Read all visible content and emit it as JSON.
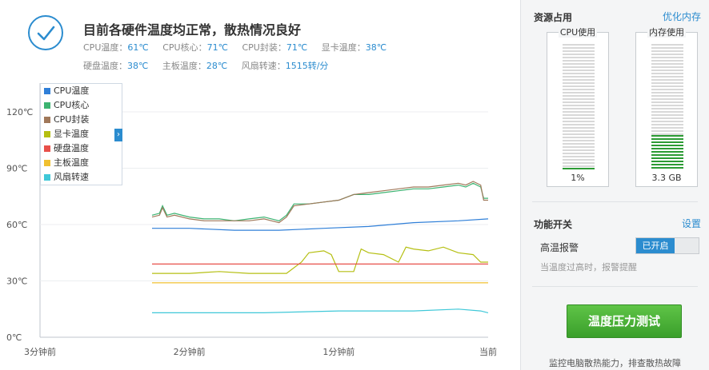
{
  "status": {
    "title": "目前各硬件温度均正常，散热情况良好",
    "temps_row1": [
      {
        "label": "CPU温度：",
        "value": "61℃"
      },
      {
        "label": "CPU核心：",
        "value": "71℃"
      },
      {
        "label": "CPU封装：",
        "value": "71℃"
      },
      {
        "label": "显卡温度：",
        "value": "38℃"
      }
    ],
    "temps_row2": [
      {
        "label": "硬盘温度：",
        "value": "38℃"
      },
      {
        "label": "主板温度：",
        "value": "28℃"
      },
      {
        "label": "风扇转速：",
        "value": "1515转/分"
      }
    ]
  },
  "chart_data": {
    "type": "line",
    "x_categories": [
      "3分钟前",
      "2分钟前",
      "1分钟前",
      "当前"
    ],
    "y_ticks": [
      "0℃",
      "30℃",
      "60℃",
      "90℃",
      "120℃"
    ],
    "ylim": [
      0,
      120
    ],
    "xlim": [
      0,
      3
    ],
    "grid": true,
    "legend_position": "top-left",
    "series": [
      {
        "name": "CPU温度",
        "color": "#2f7fd8",
        "points": [
          [
            0.75,
            58
          ],
          [
            1.0,
            58
          ],
          [
            1.3,
            57
          ],
          [
            1.6,
            57
          ],
          [
            1.9,
            58
          ],
          [
            2.2,
            59
          ],
          [
            2.5,
            61
          ],
          [
            2.8,
            62
          ],
          [
            3.0,
            63
          ]
        ]
      },
      {
        "name": "CPU核心",
        "color": "#3cb371",
        "points": [
          [
            0.75,
            65
          ],
          [
            0.8,
            66
          ],
          [
            0.82,
            70
          ],
          [
            0.85,
            65
          ],
          [
            0.9,
            66
          ],
          [
            1.0,
            64
          ],
          [
            1.1,
            63
          ],
          [
            1.2,
            63
          ],
          [
            1.3,
            62
          ],
          [
            1.4,
            63
          ],
          [
            1.5,
            64
          ],
          [
            1.55,
            63
          ],
          [
            1.6,
            62
          ],
          [
            1.65,
            65
          ],
          [
            1.7,
            71
          ],
          [
            1.8,
            71
          ],
          [
            1.9,
            72
          ],
          [
            2.0,
            73
          ],
          [
            2.1,
            76
          ],
          [
            2.2,
            76
          ],
          [
            2.3,
            77
          ],
          [
            2.4,
            78
          ],
          [
            2.5,
            79
          ],
          [
            2.6,
            79
          ],
          [
            2.7,
            80
          ],
          [
            2.8,
            81
          ],
          [
            2.85,
            80
          ],
          [
            2.9,
            82
          ],
          [
            2.95,
            80
          ],
          [
            2.97,
            74
          ],
          [
            3.0,
            74
          ]
        ]
      },
      {
        "name": "CPU封装",
        "color": "#a0785a",
        "points": [
          [
            0.75,
            64
          ],
          [
            0.8,
            65
          ],
          [
            0.82,
            69
          ],
          [
            0.85,
            64
          ],
          [
            0.9,
            65
          ],
          [
            1.0,
            63
          ],
          [
            1.1,
            62
          ],
          [
            1.2,
            62
          ],
          [
            1.3,
            62
          ],
          [
            1.4,
            62
          ],
          [
            1.5,
            63
          ],
          [
            1.55,
            62
          ],
          [
            1.6,
            61
          ],
          [
            1.65,
            64
          ],
          [
            1.7,
            70
          ],
          [
            1.8,
            71
          ],
          [
            1.9,
            72
          ],
          [
            2.0,
            73
          ],
          [
            2.1,
            76
          ],
          [
            2.2,
            77
          ],
          [
            2.3,
            78
          ],
          [
            2.4,
            79
          ],
          [
            2.5,
            80
          ],
          [
            2.6,
            80
          ],
          [
            2.7,
            81
          ],
          [
            2.8,
            82
          ],
          [
            2.85,
            81
          ],
          [
            2.9,
            83
          ],
          [
            2.95,
            81
          ],
          [
            2.97,
            73
          ],
          [
            3.0,
            73
          ]
        ]
      },
      {
        "name": "显卡温度",
        "color": "#b5bf12",
        "points": [
          [
            0.75,
            34
          ],
          [
            1.0,
            34
          ],
          [
            1.2,
            35
          ],
          [
            1.4,
            34
          ],
          [
            1.65,
            34
          ],
          [
            1.75,
            40
          ],
          [
            1.8,
            45
          ],
          [
            1.9,
            46
          ],
          [
            1.95,
            44
          ],
          [
            2.0,
            35
          ],
          [
            2.1,
            35
          ],
          [
            2.15,
            47
          ],
          [
            2.2,
            45
          ],
          [
            2.3,
            44
          ],
          [
            2.4,
            40
          ],
          [
            2.45,
            48
          ],
          [
            2.5,
            47
          ],
          [
            2.6,
            46
          ],
          [
            2.7,
            48
          ],
          [
            2.8,
            45
          ],
          [
            2.9,
            44
          ],
          [
            2.95,
            40
          ],
          [
            3.0,
            40
          ]
        ]
      },
      {
        "name": "硬盘温度",
        "color": "#e8504a",
        "points": [
          [
            0.75,
            39
          ],
          [
            3.0,
            39
          ]
        ]
      },
      {
        "name": "主板温度",
        "color": "#f0c030",
        "points": [
          [
            0.75,
            29
          ],
          [
            3.0,
            29
          ]
        ]
      },
      {
        "name": "风扇转速",
        "color": "#3fc8d8",
        "points": [
          [
            0.75,
            13
          ],
          [
            1.0,
            13
          ],
          [
            1.5,
            13
          ],
          [
            2.0,
            14
          ],
          [
            2.5,
            14
          ],
          [
            2.8,
            15
          ],
          [
            2.95,
            14
          ],
          [
            3.0,
            13
          ]
        ]
      }
    ]
  },
  "panel": {
    "resource_title": "资源占用",
    "optimize_link": "优化内存",
    "cpu": {
      "label": "CPU使用",
      "value_text": "1%",
      "percent": 1
    },
    "mem": {
      "label": "内存使用",
      "value_text": "3.3 GB",
      "percent": 28
    },
    "func_title": "功能开关",
    "settings_link": "设置",
    "alarm_label": "高温报警",
    "alarm_state": "已开启",
    "alarm_desc": "当温度过高时，报警提醒",
    "big_button": "温度压力测试",
    "button_desc": "监控电脑散热能力，排查散热故障"
  },
  "colors": {
    "accent": "#2b8ccf",
    "green": "#2c9b34"
  }
}
